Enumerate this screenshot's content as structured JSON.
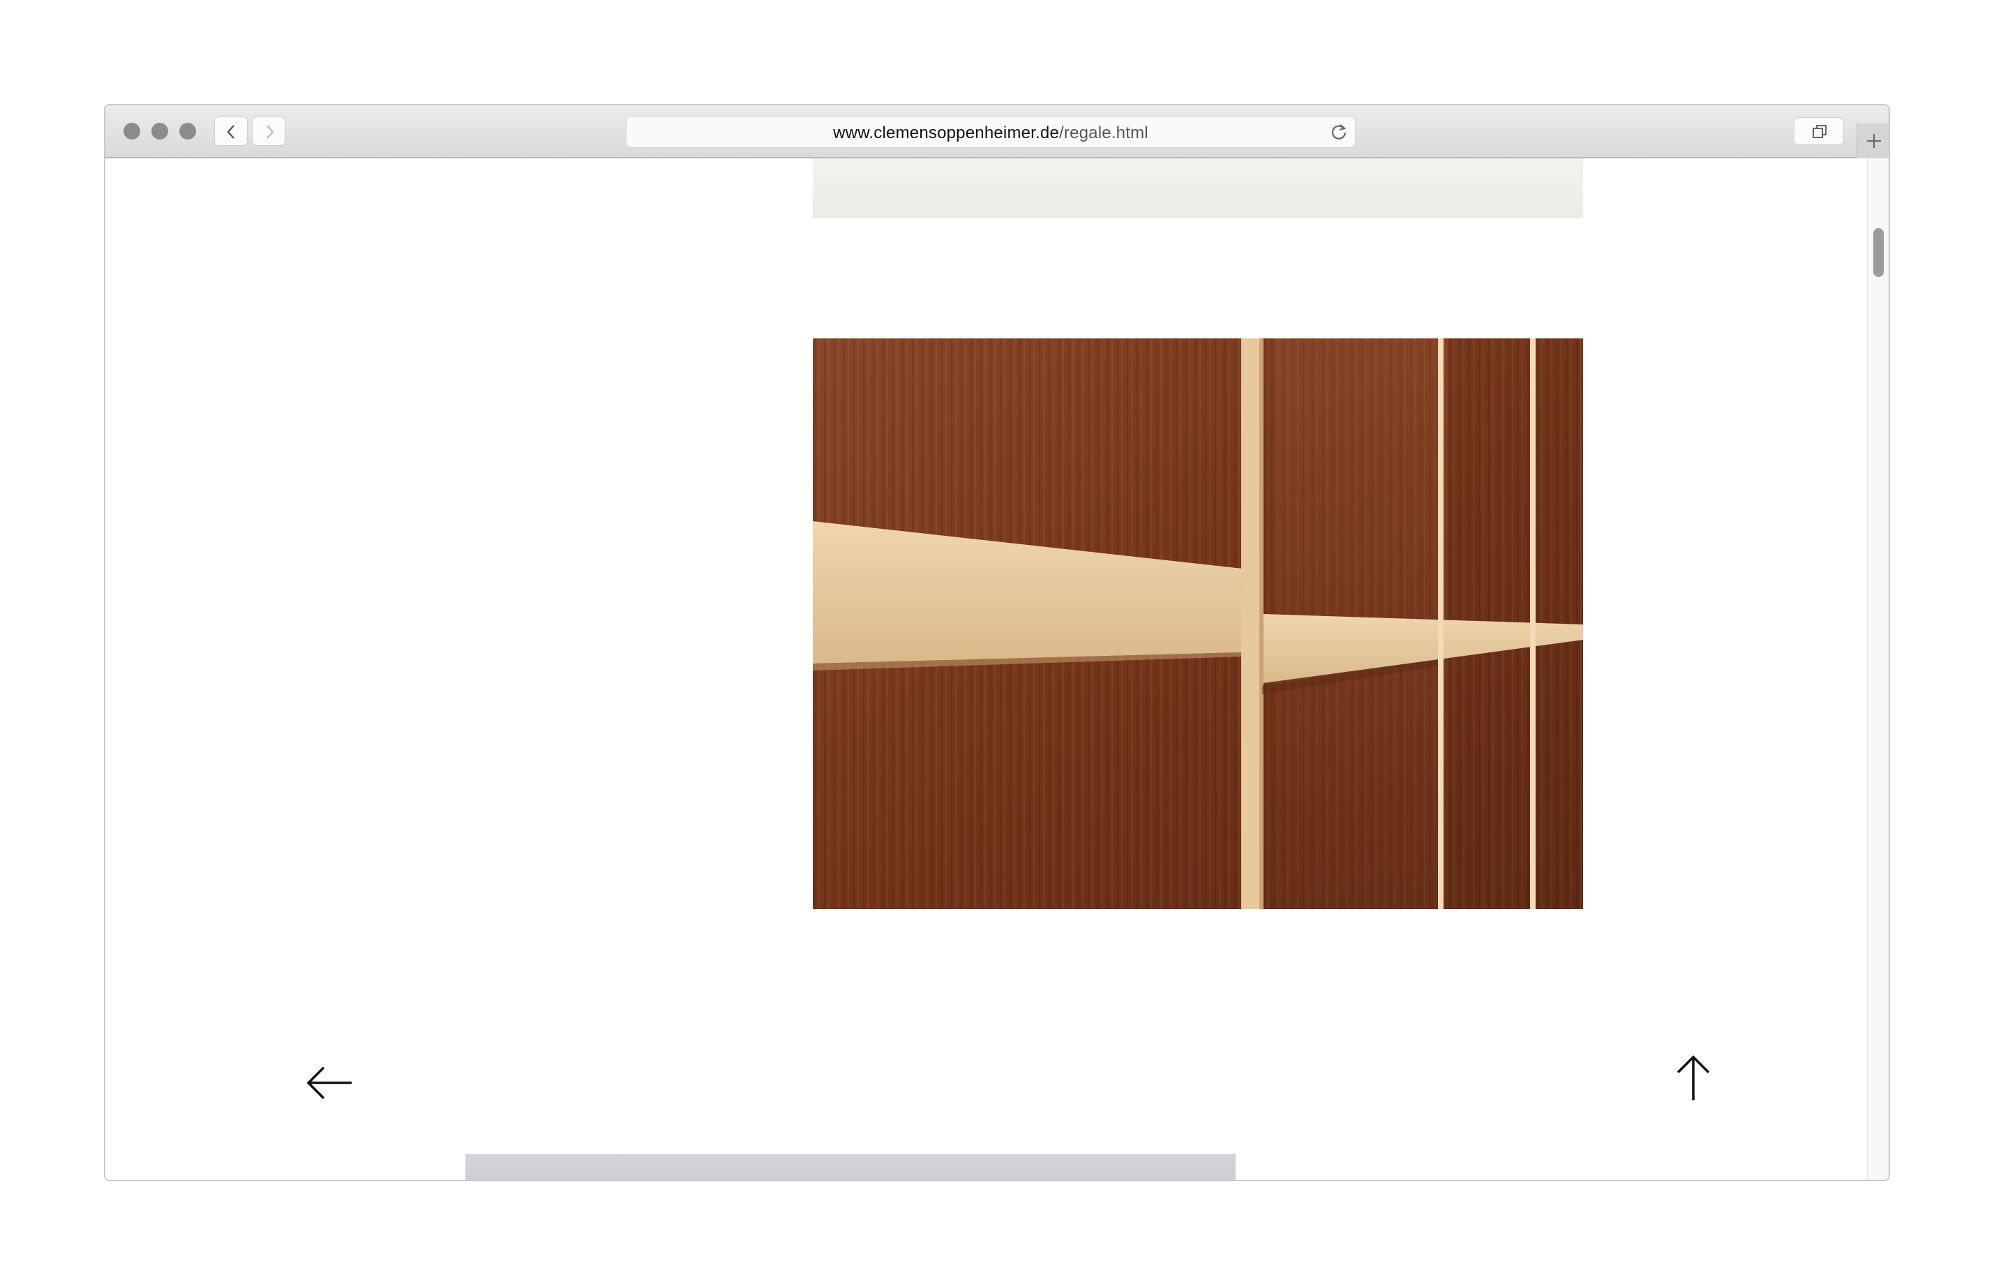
{
  "browser": {
    "url_host": "www.clemensoppenheimer.de",
    "url_path": "/regale.html",
    "icons": {
      "back": "chevron-left-icon",
      "forward": "chevron-right-icon",
      "reload": "reload-icon",
      "tabs": "tab-overview-icon",
      "new_tab": "plus-icon"
    }
  },
  "page": {
    "icons": {
      "previous": "arrow-left-icon",
      "scroll_top": "arrow-up-icon"
    }
  },
  "colors": {
    "window_border": "#c9c9c9",
    "toolbar": "#dedede",
    "traffic_light": "#8c8c8c",
    "wood_dark": "#7a3a20",
    "wood_light": "#e6cba0"
  }
}
